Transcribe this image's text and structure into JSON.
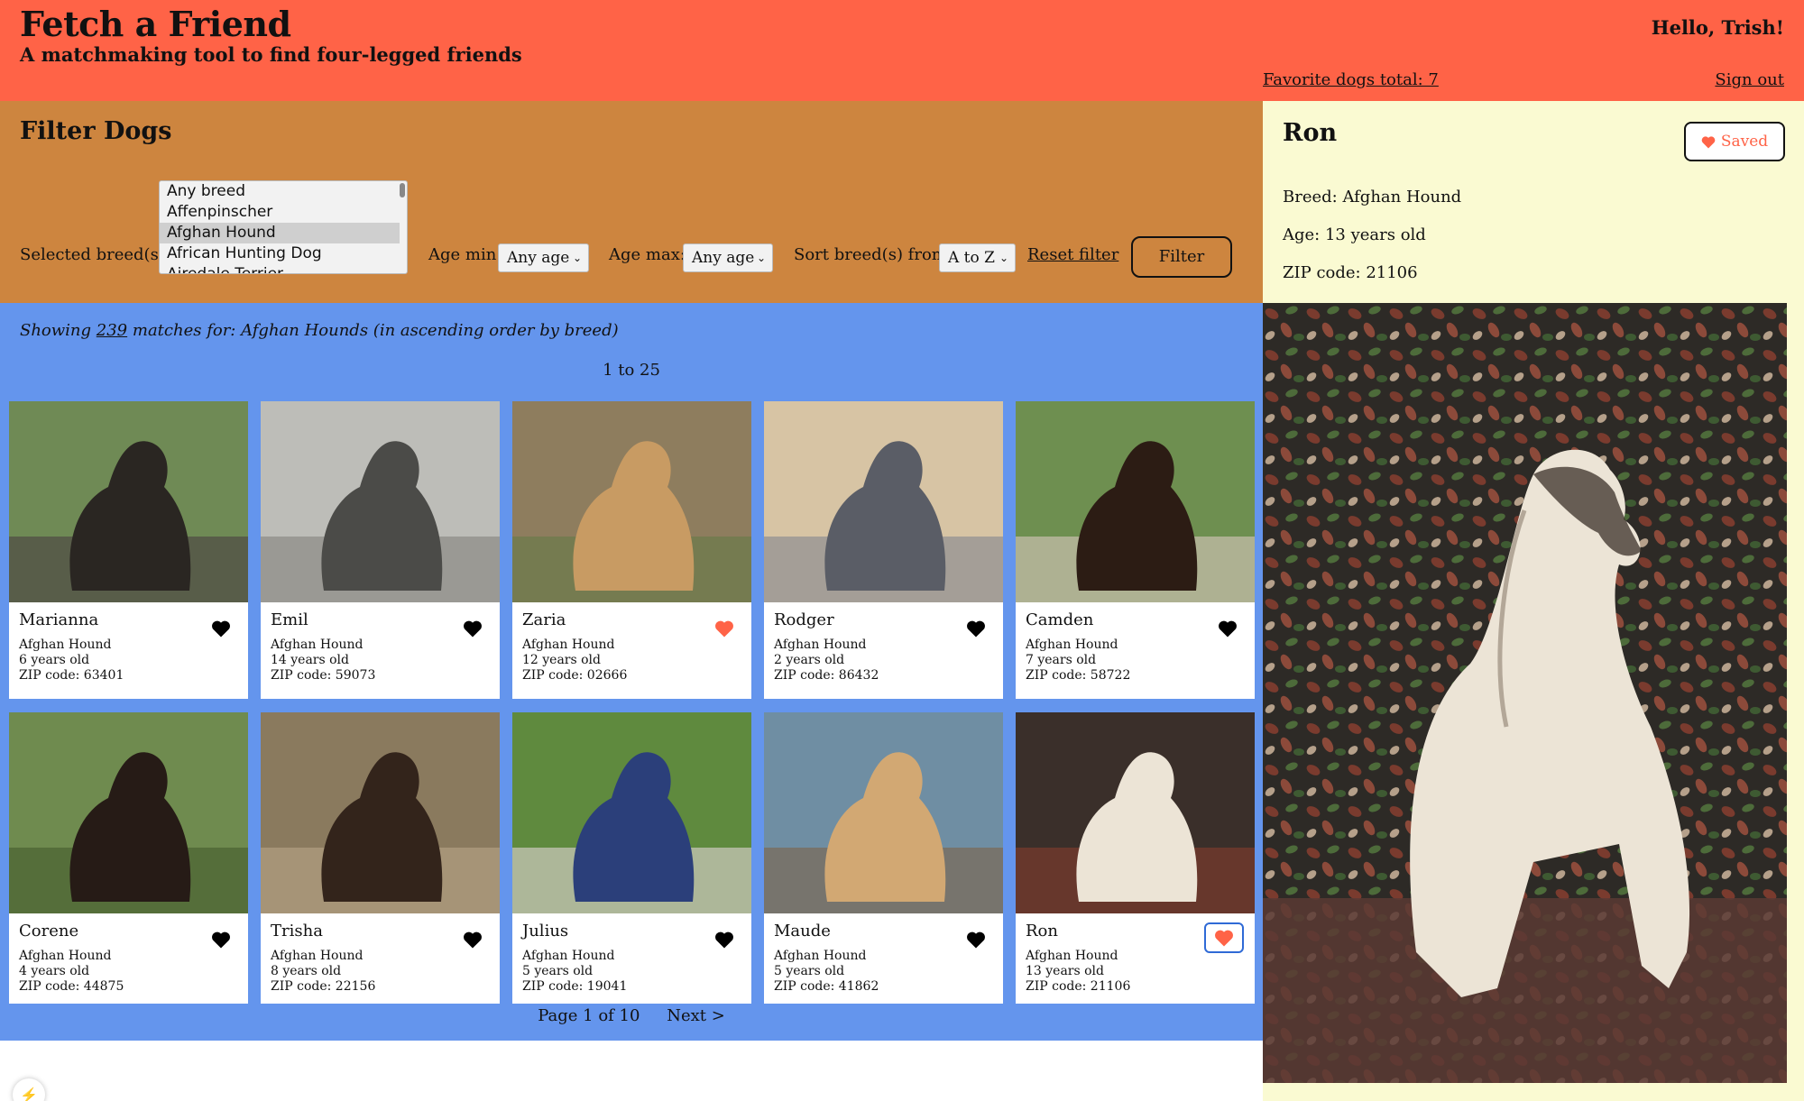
{
  "header": {
    "title": "Fetch a Friend",
    "subtitle": "A matchmaking tool to find four-legged friends",
    "greeting": "Hello, Trish!",
    "favorites_link": "Favorite dogs total: 7",
    "signout_link": "Sign out",
    "background": "#ff6347"
  },
  "filter": {
    "heading": "Filter Dogs",
    "breed_label": "Selected breed(s):",
    "breed_options": [
      "Any breed",
      "Affenpinscher",
      "Afghan Hound",
      "African Hunting Dog",
      "Airedale Terrier"
    ],
    "breed_selected": "Afghan Hound",
    "age_min_label": "Age min:",
    "age_min_value": "Any age",
    "age_max_label": "Age max:",
    "age_max_value": "Any age",
    "sort_label": "Sort breed(s) from",
    "sort_value": "A to Z",
    "reset_link": "Reset filter",
    "filter_button": "Filter",
    "background": "#cd853f"
  },
  "results": {
    "showing_prefix": "Showing",
    "match_count": "239",
    "showing_suffix": "matches for: Afghan Hounds (in ascending order by breed)",
    "range": "1 to 25",
    "background": "#6495ed",
    "dogs": [
      {
        "name": "Marianna",
        "breed": "Afghan Hound",
        "age": "6 years old",
        "zip": "ZIP code: 63401",
        "favorite": false
      },
      {
        "name": "Emil",
        "breed": "Afghan Hound",
        "age": "14 years old",
        "zip": "ZIP code: 59073",
        "favorite": false
      },
      {
        "name": "Zaria",
        "breed": "Afghan Hound",
        "age": "12 years old",
        "zip": "ZIP code: 02666",
        "favorite": true
      },
      {
        "name": "Rodger",
        "breed": "Afghan Hound",
        "age": "2 years old",
        "zip": "ZIP code: 86432",
        "favorite": false
      },
      {
        "name": "Camden",
        "breed": "Afghan Hound",
        "age": "7 years old",
        "zip": "ZIP code: 58722",
        "favorite": false
      },
      {
        "name": "Corene",
        "breed": "Afghan Hound",
        "age": "4 years old",
        "zip": "ZIP code: 44875",
        "favorite": false
      },
      {
        "name": "Trisha",
        "breed": "Afghan Hound",
        "age": "8 years old",
        "zip": "ZIP code: 22156",
        "favorite": false
      },
      {
        "name": "Julius",
        "breed": "Afghan Hound",
        "age": "5 years old",
        "zip": "ZIP code: 19041",
        "favorite": false
      },
      {
        "name": "Maude",
        "breed": "Afghan Hound",
        "age": "5 years old",
        "zip": "ZIP code: 41862",
        "favorite": false
      },
      {
        "name": "Ron",
        "breed": "Afghan Hound",
        "age": "13 years old",
        "zip": "ZIP code: 21106",
        "favorite": true
      }
    ],
    "pager": {
      "page": "Page 1 of 10",
      "next": "Next >"
    }
  },
  "detail": {
    "name": "Ron",
    "saved_button": "Saved",
    "breed": "Breed: Afghan Hound",
    "age": "Age: 13 years old",
    "zip": "ZIP code: 21106",
    "background": "#fafad2"
  },
  "icons": {
    "favorite": "heart-icon",
    "dropdown": "chevron-down-icon"
  },
  "colors": {
    "heart_on": "#ff6347",
    "heart_off": "#000000",
    "focus_ring": "#2f6ad6"
  }
}
